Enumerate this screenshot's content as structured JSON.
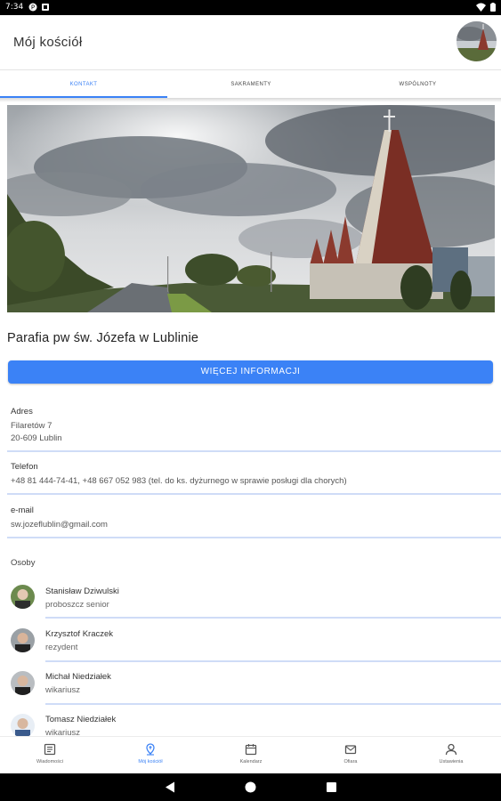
{
  "status_bar": {
    "time": "7:34",
    "icons": [
      "notification-icon",
      "alert-icon",
      "wifi-icon",
      "battery-icon"
    ]
  },
  "app_bar": {
    "title": "Mój kościół"
  },
  "tabs": [
    {
      "label": "KONTAKT",
      "active": true
    },
    {
      "label": "SAKRAMENTY",
      "active": false
    },
    {
      "label": "WSPÓLNOTY",
      "active": false
    }
  ],
  "parish": {
    "name": "Parafia pw św. Józefa w Lublinie",
    "more_button": "WIĘCEJ INFORMACJI"
  },
  "contact": {
    "address_label": "Adres",
    "address_line1": "Filaretów 7",
    "address_line2": "20-609 Lublin",
    "phone_label": "Telefon",
    "phone_value": "+48 81 444-74-41, +48 667 052 983 (tel. do ks. dyżurnego w sprawie posługi dla chorych)",
    "email_label": "e-mail",
    "email_value": "sw.jozeflublin@gmail.com"
  },
  "people": {
    "label": "Osoby",
    "list": [
      {
        "name": "Stanisław Dziwulski",
        "role": "proboszcz senior"
      },
      {
        "name": "Krzysztof Kraczek",
        "role": "rezydent"
      },
      {
        "name": "Michał Niedziałek",
        "role": "wikariusz"
      },
      {
        "name": "Tomasz Niedziałek",
        "role": "wikariusz"
      }
    ]
  },
  "bottom_nav": [
    {
      "label": "Wiadomości",
      "icon": "news-icon",
      "active": false
    },
    {
      "label": "Mój kościół",
      "icon": "church-pin-icon",
      "active": true
    },
    {
      "label": "Kalendarz",
      "icon": "calendar-icon",
      "active": false
    },
    {
      "label": "Ofiara",
      "icon": "envelope-icon",
      "active": false
    },
    {
      "label": "Ustawienia",
      "icon": "person-icon",
      "active": false
    }
  ],
  "colors": {
    "accent": "#3b82f6",
    "divider": "#cfdcf7"
  }
}
